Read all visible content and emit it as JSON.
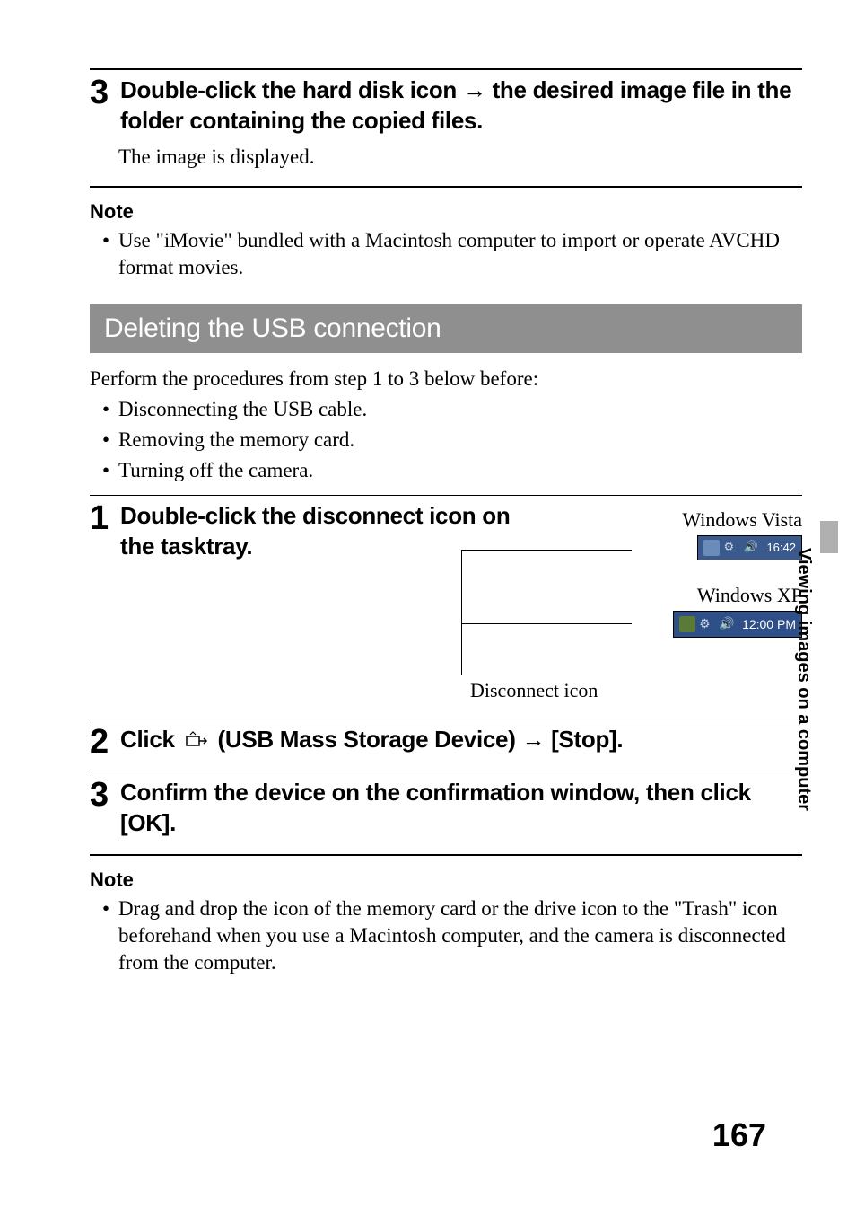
{
  "step3_top": {
    "num": "3",
    "text_a": "Double-click the hard disk icon ",
    "arrow": "→",
    "text_b": " the desired image file in the folder containing the copied files.",
    "body": "The image is displayed."
  },
  "note1": {
    "head": "Note",
    "bullet": "Use \"iMovie\" bundled with a Macintosh computer to import or operate AVCHD format movies."
  },
  "section_title": "Deleting the USB connection",
  "intro": "Perform the procedures from step 1 to 3 below before:",
  "intro_bullets": [
    "Disconnecting the USB cable.",
    "Removing the memory card.",
    "Turning off the camera."
  ],
  "step1": {
    "num": "1",
    "text": "Double-click the disconnect icon on the tasktray.",
    "vista_label": "Windows Vista",
    "vista_time": "16:42",
    "xp_label": "Windows XP",
    "xp_time": "12:00 PM",
    "disconnect_label": "Disconnect icon"
  },
  "step2": {
    "num": "2",
    "text_a": "Click ",
    "text_b": " (USB Mass Storage Device) ",
    "arrow": "→",
    "text_c": " [Stop]."
  },
  "step3": {
    "num": "3",
    "text": "Confirm the device on the confirmation window, then click [OK]."
  },
  "note2": {
    "head": "Note",
    "bullet": "Drag and drop the icon of the memory card or the drive icon to the \"Trash\" icon beforehand when you use a Macintosh computer, and the camera is disconnected from the computer."
  },
  "side_tab": "Viewing images on a computer",
  "page_number": "167"
}
